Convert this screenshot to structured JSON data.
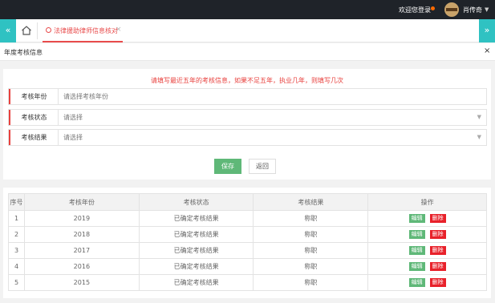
{
  "header": {
    "welcome": "欢迎您登录",
    "username": "肖传奇",
    "user_caret": "▼",
    "status_color": "#ff6a00"
  },
  "tabs": {
    "nav_left": "«",
    "nav_right": "»",
    "home_icon": "home-icon",
    "active_tab": "法律援助律师信息核对",
    "close": "×"
  },
  "section": {
    "title": "年度考核信息",
    "close": "×"
  },
  "form": {
    "tip": "请填写最近五年的考核信息，如果不足五年，执业几年，则填写几次",
    "fields": [
      {
        "label": "考核年份",
        "placeholder": "请选择考核年份"
      },
      {
        "label": "考核状态",
        "placeholder": "请选择",
        "caret": "▼"
      },
      {
        "label": "考核结果",
        "placeholder": "请选择",
        "caret": "▼"
      }
    ],
    "save_label": "保存",
    "back_label": "返回"
  },
  "table": {
    "headers": [
      "序号",
      "考核年份",
      "考核状态",
      "考核结果",
      "操作"
    ],
    "edit_label": "编辑",
    "delete_label": "删除",
    "rows": [
      {
        "index": "1",
        "year": "2019",
        "status": "已确定考核结果",
        "result": "称职"
      },
      {
        "index": "2",
        "year": "2018",
        "status": "已确定考核结果",
        "result": "称职"
      },
      {
        "index": "3",
        "year": "2017",
        "status": "已确定考核结果",
        "result": "称职"
      },
      {
        "index": "4",
        "year": "2016",
        "status": "已确定考核结果",
        "result": "称职"
      },
      {
        "index": "5",
        "year": "2015",
        "status": "已确定考核结果",
        "result": "称职"
      }
    ]
  },
  "colors": {
    "accent_teal": "#2fc2c2",
    "accent_red": "#e84b4b",
    "save_green": "#5fb878",
    "delete_red": "#e8212a"
  }
}
